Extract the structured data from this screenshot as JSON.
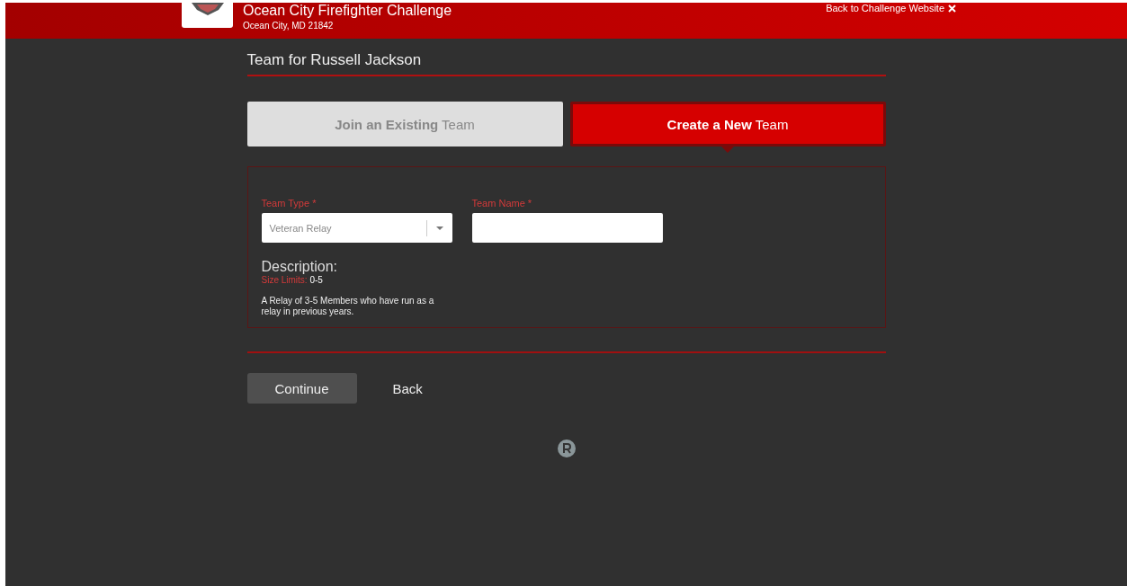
{
  "header": {
    "title": "Ocean City Firefighter Challenge",
    "subtitle": "Ocean City, MD 21842",
    "back_link": "Back to Challenge Website"
  },
  "page_title": "Team for Russell Jackson",
  "tabs": [
    {
      "label": "**Join an Existing** Team",
      "selected": false
    },
    {
      "label": "**Create a New** Team",
      "selected": true
    }
  ],
  "form": {
    "team_type": {
      "label": "Team Type",
      "required_mark": "*",
      "value": "Veteran Relay"
    },
    "team_name": {
      "label": "Team Name",
      "required_mark": "*"
    },
    "description": {
      "heading": "Description:",
      "size_limits_label": "Size Limits:",
      "size_limits_value": "0-5",
      "text": "A Relay of 3-5 Members who have run as a relay in previous years."
    }
  },
  "buttons": {
    "continue": "Continue",
    "back": "Back"
  }
}
